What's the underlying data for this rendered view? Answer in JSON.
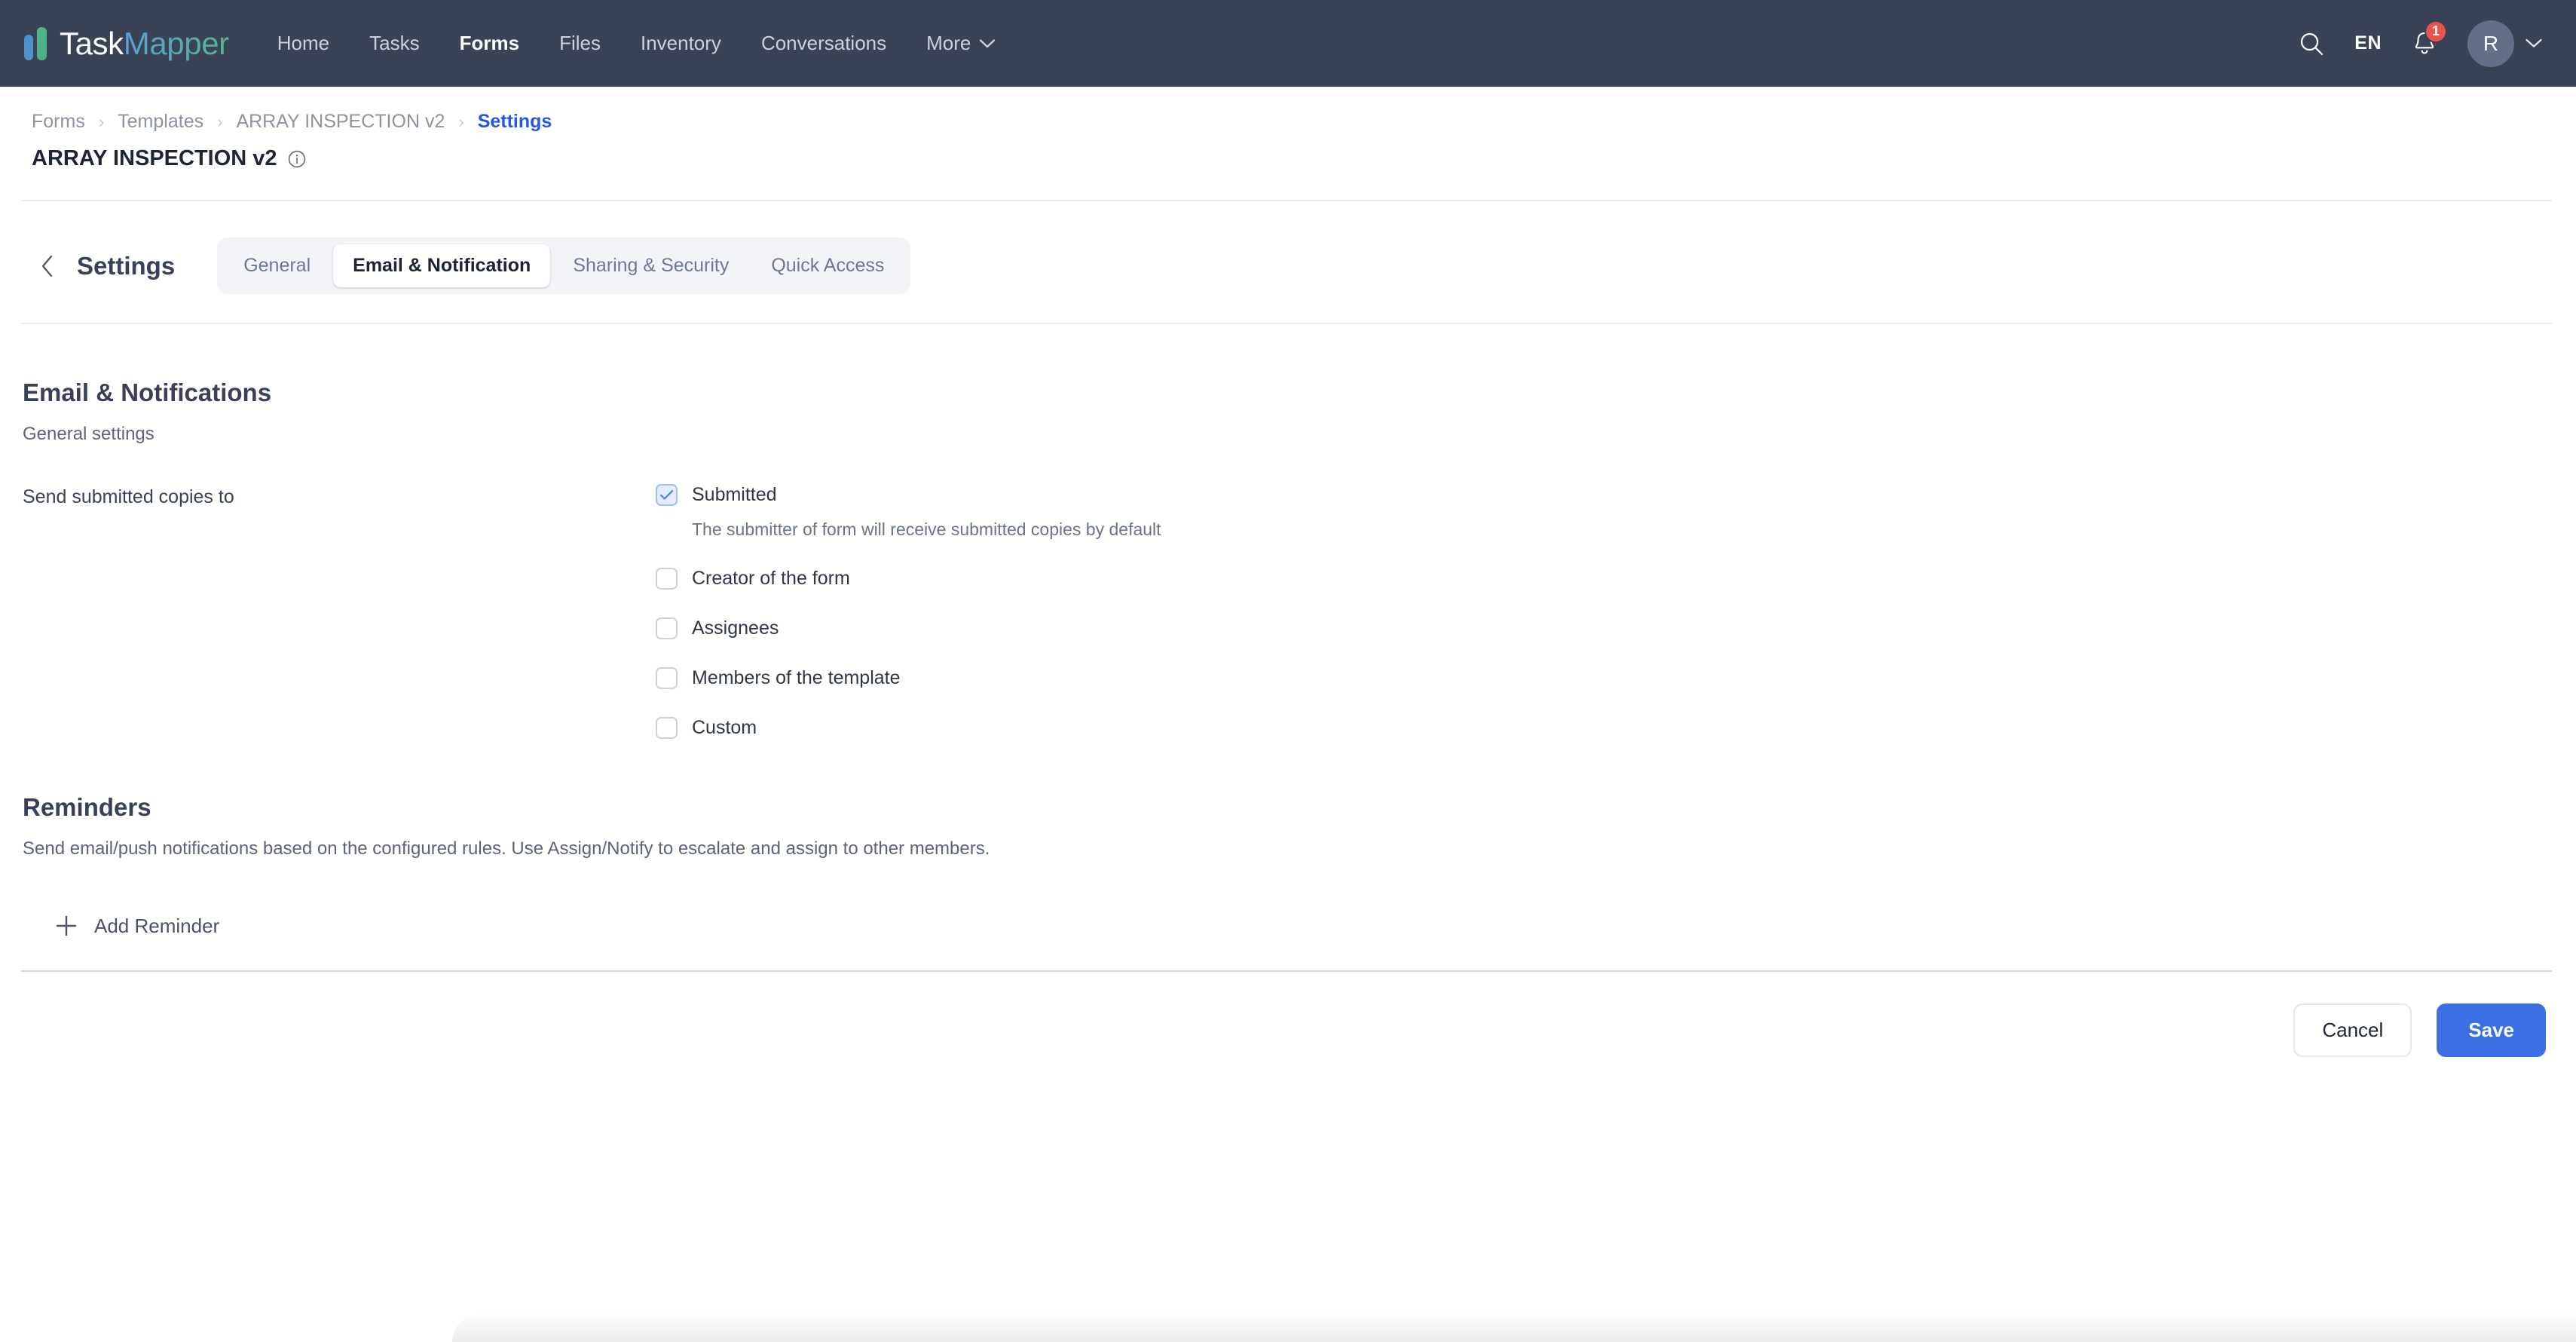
{
  "navbar": {
    "brand": {
      "part1": "Task",
      "part2": "Mapper"
    },
    "links": [
      {
        "label": "Home",
        "active": false
      },
      {
        "label": "Tasks",
        "active": false
      },
      {
        "label": "Forms",
        "active": true
      },
      {
        "label": "Files",
        "active": false
      },
      {
        "label": "Inventory",
        "active": false
      },
      {
        "label": "Conversations",
        "active": false
      }
    ],
    "more_label": "More",
    "search_icon": "search-icon",
    "language": "EN",
    "notification_icon": "bell-icon",
    "notification_count": "1",
    "avatar_initial": "R",
    "avatar_chevron": "chevron-down-icon"
  },
  "breadcrumb": {
    "items": [
      {
        "label": "Forms",
        "current": false
      },
      {
        "label": "Templates",
        "current": false
      },
      {
        "label": "ARRAY INSPECTION v2",
        "current": false
      },
      {
        "label": "Settings",
        "current": true
      }
    ],
    "separator": "›"
  },
  "page": {
    "title": "ARRAY INSPECTION v2",
    "info_icon": "info-circle-icon"
  },
  "settings": {
    "back_icon": "chevron-left-icon",
    "heading": "Settings",
    "tabs": [
      {
        "label": "General",
        "active": false
      },
      {
        "label": "Email & Notification",
        "active": true
      },
      {
        "label": "Sharing & Security",
        "active": false
      },
      {
        "label": "Quick Access",
        "active": false
      }
    ]
  },
  "email_section": {
    "title": "Email & Notifications",
    "subtitle": "General settings",
    "field_label": "Send submitted copies to",
    "options": [
      {
        "label": "Submitted",
        "checked": true,
        "hint": "The submitter of form will receive submitted copies by default"
      },
      {
        "label": "Creator of the form",
        "checked": false
      },
      {
        "label": "Assignees",
        "checked": false
      },
      {
        "label": "Members of the template",
        "checked": false
      },
      {
        "label": "Custom",
        "checked": false
      }
    ]
  },
  "reminders_section": {
    "title": "Reminders",
    "subtitle": "Send email/push notifications based on the configured rules. Use Assign/Notify to escalate and assign to other members.",
    "add_label": "Add Reminder",
    "add_icon": "plus-icon"
  },
  "footer": {
    "cancel_label": "Cancel",
    "save_label": "Save"
  },
  "colors": {
    "navbar_bg": "#3a4255",
    "accent_blue": "#3b6fe4",
    "breadcrumb_active": "#2558e8",
    "badge_red": "#e8544a",
    "checkbox_checked_bg": "#e4edfd"
  }
}
